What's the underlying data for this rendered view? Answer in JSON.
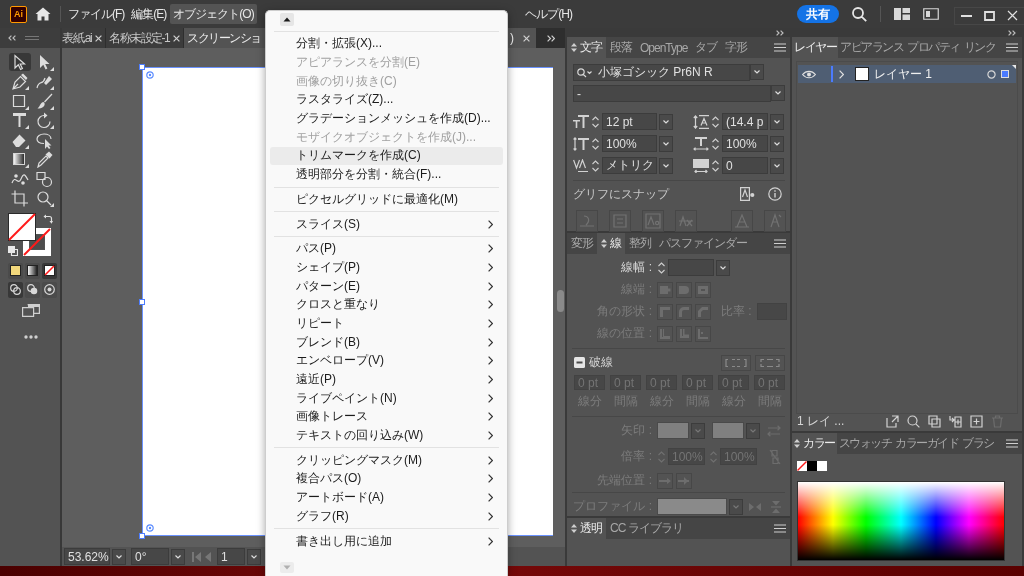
{
  "app_bar": {
    "logo": "Ai",
    "menus": [
      {
        "label": "ファイル(F)",
        "selected": false
      },
      {
        "label": "編集(E)",
        "selected": false
      },
      {
        "label": "オブジェクト(O)",
        "selected": true
      },
      {
        "label": "ヘルプ(H)",
        "selected": false
      }
    ],
    "share_button": "共有"
  },
  "toolbar": {
    "tools": [
      {
        "kind": "selection",
        "selected": true
      },
      {
        "kind": "direct-selection",
        "selected": false
      },
      {
        "kind": "pen",
        "selected": false
      },
      {
        "kind": "curvature",
        "selected": false
      },
      {
        "kind": "rectangle",
        "selected": false
      },
      {
        "kind": "paintbrush",
        "selected": false
      },
      {
        "kind": "type",
        "selected": false
      },
      {
        "kind": "rotate",
        "selected": false
      },
      {
        "kind": "eraser",
        "selected": false
      },
      {
        "kind": "shaper",
        "selected": false
      },
      {
        "kind": "gradient",
        "selected": false
      },
      {
        "kind": "eyedropper",
        "selected": false
      },
      {
        "kind": "puppet-warp",
        "selected": false
      },
      {
        "kind": "shape-builder",
        "selected": false
      },
      {
        "kind": "artboard",
        "selected": false
      },
      {
        "kind": "zoom",
        "selected": false
      }
    ],
    "no_fill": true,
    "no_stroke": true,
    "color_modes": [
      {
        "kind": "color",
        "selected": false
      },
      {
        "kind": "gradient",
        "selected": false
      },
      {
        "kind": "none",
        "selected": true
      }
    ],
    "draw_modes": [
      {
        "kind": "normal",
        "selected": true
      },
      {
        "kind": "behind",
        "selected": false
      },
      {
        "kind": "inside",
        "selected": false
      }
    ]
  },
  "document_tabs": [
    {
      "title": "表紙.ai",
      "selected": false
    },
    {
      "title": "名称未設定-1",
      "selected": false
    },
    {
      "title": "スクリーンショ",
      "title_end": ")",
      "selected": true
    }
  ],
  "status_bar": {
    "zoom": "53.62%",
    "rotation": "0°",
    "artboard": "1"
  },
  "object_menu": {
    "groups": [
      [
        {
          "label": "分割・拡張(X)...",
          "disabled": false,
          "highlighted": false,
          "submenu": false
        },
        {
          "label": "アピアランスを分割(E)",
          "disabled": true,
          "highlighted": false,
          "submenu": false
        },
        {
          "label": "画像の切り抜き(C)",
          "disabled": true,
          "highlighted": false,
          "submenu": false
        },
        {
          "label": "ラスタライズ(Z)...",
          "disabled": false,
          "highlighted": false,
          "submenu": false
        },
        {
          "label": "グラデーションメッシュを作成(D)...",
          "disabled": false,
          "highlighted": false,
          "submenu": false
        },
        {
          "label": "モザイクオブジェクトを作成(J)...",
          "disabled": true,
          "highlighted": false,
          "submenu": false
        },
        {
          "label": "トリムマークを作成(C)",
          "disabled": false,
          "highlighted": true,
          "submenu": false
        },
        {
          "label": "透明部分を分割・統合(F)...",
          "disabled": false,
          "highlighted": false,
          "submenu": false
        }
      ],
      [
        {
          "label": "ピクセルグリッドに最適化(M)",
          "disabled": false,
          "highlighted": false,
          "submenu": false
        }
      ],
      [
        {
          "label": "スライス(S)",
          "disabled": false,
          "highlighted": false,
          "submenu": true
        }
      ],
      [
        {
          "label": "パス(P)",
          "disabled": false,
          "highlighted": false,
          "submenu": true
        },
        {
          "label": "シェイプ(P)",
          "disabled": false,
          "highlighted": false,
          "submenu": true
        },
        {
          "label": "パターン(E)",
          "disabled": false,
          "highlighted": false,
          "submenu": true
        },
        {
          "label": "クロスと重なり",
          "disabled": false,
          "highlighted": false,
          "submenu": true
        },
        {
          "label": "リピート",
          "disabled": false,
          "highlighted": false,
          "submenu": true
        },
        {
          "label": "ブレンド(B)",
          "disabled": false,
          "highlighted": false,
          "submenu": true
        },
        {
          "label": "エンベロープ(V)",
          "disabled": false,
          "highlighted": false,
          "submenu": true
        },
        {
          "label": "遠近(P)",
          "disabled": false,
          "highlighted": false,
          "submenu": true
        },
        {
          "label": "ライブペイント(N)",
          "disabled": false,
          "highlighted": false,
          "submenu": true
        },
        {
          "label": "画像トレース",
          "disabled": false,
          "highlighted": false,
          "submenu": true
        },
        {
          "label": "テキストの回り込み(W)",
          "disabled": false,
          "highlighted": false,
          "submenu": true
        }
      ],
      [
        {
          "label": "クリッピングマスク(M)",
          "disabled": false,
          "highlighted": false,
          "submenu": true
        },
        {
          "label": "複合パス(O)",
          "disabled": false,
          "highlighted": false,
          "submenu": true
        },
        {
          "label": "アートボード(A)",
          "disabled": false,
          "highlighted": false,
          "submenu": true
        },
        {
          "label": "グラフ(R)",
          "disabled": false,
          "highlighted": false,
          "submenu": true
        }
      ],
      [
        {
          "label": "書き出し用に追加",
          "disabled": false,
          "highlighted": false,
          "submenu": true
        }
      ]
    ]
  },
  "character_panel": {
    "tabs": [
      {
        "label": "文字",
        "selected": true
      },
      {
        "label": "段落",
        "selected": false
      },
      {
        "label": "OpenType",
        "selected": false
      },
      {
        "label": "タブ",
        "selected": false
      },
      {
        "label": "字形",
        "selected": false
      }
    ],
    "font_family": "小塚ゴシック Pr6N R",
    "font_style": "-",
    "fields": [
      {
        "kind": "font-size",
        "value": "12 pt"
      },
      {
        "kind": "leading",
        "value": "(14.4 p"
      },
      {
        "kind": "vertical-scale",
        "value": "100%"
      },
      {
        "kind": "horizontal-scale",
        "value": "100%"
      },
      {
        "kind": "kerning",
        "value": "メトリク"
      },
      {
        "kind": "tracking",
        "value": "0"
      }
    ],
    "snap_label": "グリフにスナップ"
  },
  "stroke_panel": {
    "tabs": [
      {
        "label": "変形",
        "selected": false
      },
      {
        "label": "線",
        "selected": true
      },
      {
        "label": "整列",
        "selected": false
      },
      {
        "label": "パスファインダー",
        "selected": false
      }
    ],
    "rows": [
      {
        "kind": "weight",
        "label": "線幅 :",
        "disabled": false
      },
      {
        "kind": "caps",
        "label": "線端 :",
        "disabled": true
      },
      {
        "kind": "corners",
        "label": "角の形状 :",
        "extra_label": "比率 :",
        "disabled": true
      },
      {
        "kind": "align",
        "label": "線の位置 :",
        "disabled": true
      },
      {
        "kind": "dashed",
        "label": "破線",
        "mixed": true,
        "disabled": false
      },
      {
        "kind": "dash-fields",
        "fields": [
          {
            "value": "0 pt",
            "label": "線分"
          },
          {
            "value": "0 pt",
            "label": "間隔"
          },
          {
            "value": "0 pt",
            "label": "線分"
          },
          {
            "value": "0 pt",
            "label": "間隔"
          },
          {
            "value": "0 pt",
            "label": "線分"
          },
          {
            "value": "0 pt",
            "label": "間隔"
          }
        ],
        "disabled": true
      },
      {
        "kind": "arrowheads",
        "label": "矢印 :",
        "disabled": true
      },
      {
        "kind": "arrow-scale",
        "label": "倍率 :",
        "values": [
          "100%",
          "100%"
        ],
        "disabled": true
      },
      {
        "kind": "arrow-tip",
        "label": "先端位置 :",
        "disabled": true
      },
      {
        "kind": "profile",
        "label": "プロファイル :",
        "disabled": true
      }
    ]
  },
  "transparency_panel": {
    "tabs": [
      {
        "label": "透明",
        "selected": true
      },
      {
        "label": "CC ライブラリ",
        "selected": false
      }
    ]
  },
  "layers_panel": {
    "tabs": [
      {
        "label": "レイヤー",
        "selected": true
      },
      {
        "label": "アピアランス",
        "selected": false
      },
      {
        "label": "プロパティ",
        "selected": false
      },
      {
        "label": "リンク",
        "selected": false
      }
    ],
    "layers": [
      {
        "name": "レイヤー 1",
        "visible": true,
        "expanded": false,
        "selected": true
      }
    ],
    "footer": "1 レイ ..."
  },
  "color_panel": {
    "tabs": [
      {
        "label": "カラー",
        "selected": true
      },
      {
        "label": "スウォッチ",
        "selected": false
      },
      {
        "label": "カラーガイド",
        "selected": false
      },
      {
        "label": "ブラシ",
        "selected": false
      }
    ]
  }
}
